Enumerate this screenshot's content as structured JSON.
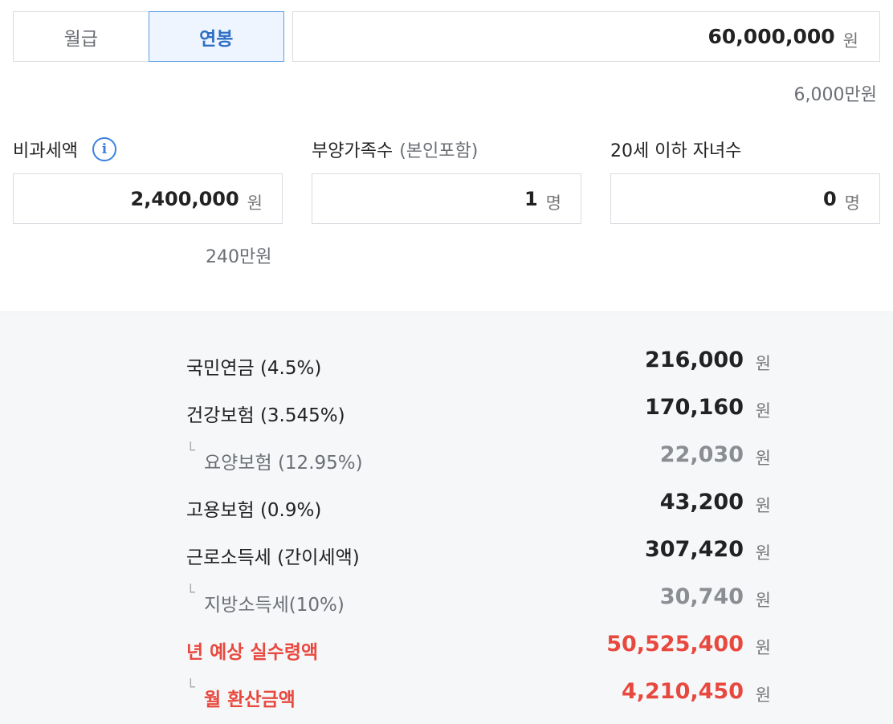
{
  "toggle": {
    "monthly_label": "월급",
    "annual_label": "연봉",
    "active": "annual"
  },
  "salary": {
    "value": "60,000,000",
    "unit": "원",
    "hint": "6,000만원"
  },
  "fields": {
    "nontaxable": {
      "label": "비과세액",
      "value": "2,400,000",
      "unit": "원",
      "hint": "240만원",
      "info_icon": "info-icon"
    },
    "dependents": {
      "label": "부양가족수",
      "sublabel": "(본인포함)",
      "value": "1",
      "unit": "명"
    },
    "children": {
      "label": "20세 이하 자녀수",
      "value": "0",
      "unit": "명"
    }
  },
  "results": [
    {
      "label": "국민연금 (4.5%)",
      "value": "216,000",
      "unit": "원",
      "type": "main"
    },
    {
      "label": "건강보험 (3.545%)",
      "value": "170,160",
      "unit": "원",
      "type": "main"
    },
    {
      "label": "요양보험 (12.95%)",
      "value": "22,030",
      "unit": "원",
      "type": "sub"
    },
    {
      "label": "고용보험 (0.9%)",
      "value": "43,200",
      "unit": "원",
      "type": "main"
    },
    {
      "label": "근로소득세 (간이세액)",
      "value": "307,420",
      "unit": "원",
      "type": "main"
    },
    {
      "label": "지방소득세(10%)",
      "value": "30,740",
      "unit": "원",
      "type": "sub"
    },
    {
      "label": "년 예상 실수령액",
      "value": "50,525,400",
      "unit": "원",
      "type": "highlight"
    },
    {
      "label": "월 환산금액",
      "value": "4,210,450",
      "unit": "원",
      "type": "highlight-sub"
    }
  ],
  "colors": {
    "accent": "#2f6fc4",
    "highlight": "#e8493f",
    "result_bg": "#f6f7f9"
  }
}
